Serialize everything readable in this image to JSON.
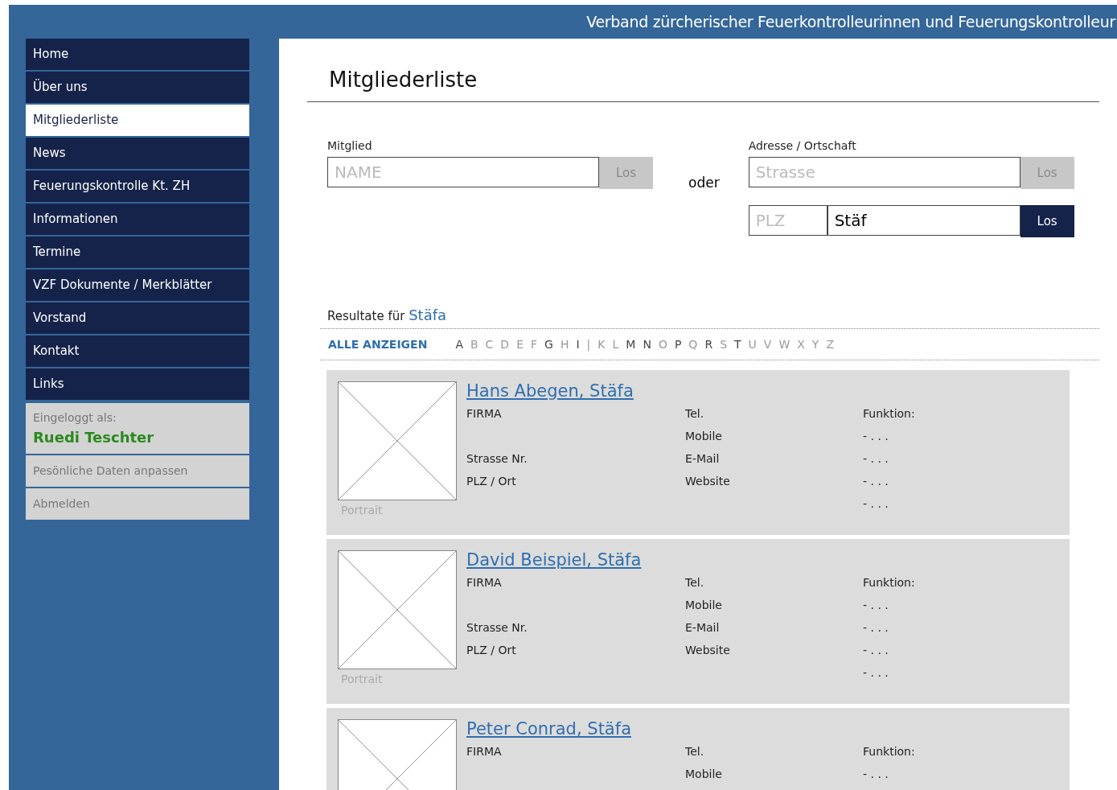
{
  "header": {
    "title": "Verband zürcherischer Feuerkontrolleurinnen und Feuerungskontrolleur"
  },
  "nav": [
    {
      "label": "Home",
      "selected": false
    },
    {
      "label": "Über uns",
      "selected": false
    },
    {
      "label": "Mitgliederliste",
      "selected": true
    },
    {
      "label": "News",
      "selected": false
    },
    {
      "label": "Feuerungskontrolle Kt. ZH",
      "selected": false
    },
    {
      "label": "Informationen",
      "selected": false
    },
    {
      "label": "Termine",
      "selected": false
    },
    {
      "label": "VZF Dokumente / Merkblätter",
      "selected": false
    },
    {
      "label": "Vorstand",
      "selected": false
    },
    {
      "label": "Kontakt",
      "selected": false
    },
    {
      "label": "Links",
      "selected": false
    }
  ],
  "login": {
    "caption": "Eingeloggt als:",
    "user": "Ruedi Teschter",
    "links": [
      "Pesönliche Daten anpassen",
      "Abmelden"
    ]
  },
  "page_title": "Mitgliederliste",
  "search": {
    "member_label": "Mitglied",
    "name_placeholder": "NAME",
    "name_button": {
      "label": "Los",
      "active": false
    },
    "or": "oder",
    "address_label": "Adresse / Ortschaft",
    "street_placeholder": "Strasse",
    "street_button": {
      "label": "Los",
      "active": false
    },
    "zip_placeholder": "PLZ",
    "place_value": "Stäf",
    "place_button": {
      "label": "Los",
      "active": true
    }
  },
  "results": {
    "prefix": "Resultate für",
    "query": "Stäfa"
  },
  "alphabet": {
    "all": "ALLE ANZEIGEN",
    "letters": [
      {
        "label": "A",
        "available": true
      },
      {
        "label": "B",
        "available": false
      },
      {
        "label": "C",
        "available": false
      },
      {
        "label": "D",
        "available": false
      },
      {
        "label": "E",
        "available": false
      },
      {
        "label": "F",
        "available": false
      },
      {
        "label": "G",
        "available": true
      },
      {
        "label": "H",
        "available": false
      },
      {
        "label": "I",
        "available": true
      },
      {
        "label": "|",
        "available": false
      },
      {
        "label": "K",
        "available": false
      },
      {
        "label": "L",
        "available": false
      },
      {
        "label": "M",
        "available": true
      },
      {
        "label": "N",
        "available": true
      },
      {
        "label": "O",
        "available": false
      },
      {
        "label": "P",
        "available": true
      },
      {
        "label": "Q",
        "available": false
      },
      {
        "label": "R",
        "available": true
      },
      {
        "label": "S",
        "available": false
      },
      {
        "label": "T",
        "available": true
      },
      {
        "label": "U",
        "available": false
      },
      {
        "label": "V",
        "available": false
      },
      {
        "label": "W",
        "available": false
      },
      {
        "label": "X",
        "available": false
      },
      {
        "label": "Y",
        "available": false
      },
      {
        "label": "Z",
        "available": false
      }
    ]
  },
  "members": [
    {
      "name": "Hans Abegen, Stäfa",
      "portrait_label": "Portrait",
      "rows": [
        {
          "col_1": "FIRMA",
          "col_2": "Tel.",
          "col_3": "Funktion:"
        },
        {
          "col_2": "Mobile",
          "col_3": "- . . ."
        },
        {
          "col_1": "Strasse Nr.",
          "col_2": "E-Mail",
          "col_3": "- . . ."
        },
        {
          "col_1": "PLZ / Ort",
          "col_2": "Website",
          "col_3": "- . . ."
        },
        {
          "col_3": "- . . ."
        }
      ]
    },
    {
      "name": "David Beispiel, Stäfa",
      "portrait_label": "Portrait",
      "rows": [
        {
          "col_1": "FIRMA",
          "col_2": "Tel.",
          "col_3": "Funktion:"
        },
        {
          "col_2": "Mobile",
          "col_3": "- . . ."
        },
        {
          "col_1": "Strasse Nr.",
          "col_2": "E-Mail",
          "col_3": "- . . ."
        },
        {
          "col_1": "PLZ / Ort",
          "col_2": "Website",
          "col_3": "- . . ."
        },
        {
          "col_3": "- . . ."
        }
      ]
    },
    {
      "name": "Peter Conrad, Stäfa",
      "rows": [
        {
          "col_1": "FIRMA",
          "col_2": "Tel.",
          "col_3": "Funktion:"
        },
        {
          "col_2": "Mobile",
          "col_3": "- . . ."
        }
      ]
    }
  ]
}
